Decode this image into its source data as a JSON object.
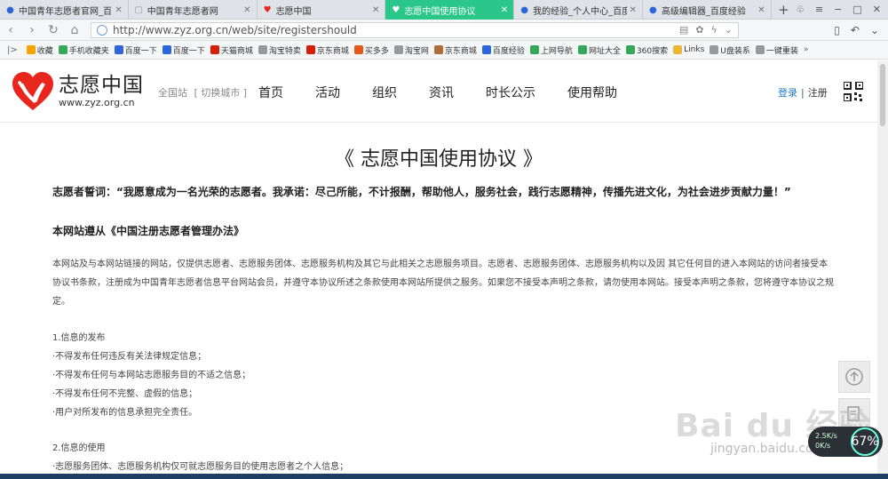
{
  "browser": {
    "tabs": [
      {
        "title": "中国青年志愿者官网_百度",
        "icon": "paw-icon",
        "active": false
      },
      {
        "title": "中国青年志愿者网",
        "icon": "page-icon",
        "active": false
      },
      {
        "title": "志愿中国",
        "icon": "heart-icon",
        "active": false
      },
      {
        "title": "志愿中国使用协议",
        "icon": "heart-icon",
        "active": true
      },
      {
        "title": "我的经验_个人中心_百度经",
        "icon": "paw-icon",
        "active": false
      },
      {
        "title": "高级编辑器_百度经验",
        "icon": "paw-icon",
        "active": false
      }
    ],
    "url": "http://www.zyz.org.cn/web/site/registershould",
    "bookmarks": [
      {
        "label": "收藏",
        "icon": "star-icon",
        "color": "#f3a400"
      },
      {
        "label": "手机收藏夹",
        "icon": "phone-icon",
        "color": "#36a85a"
      },
      {
        "label": "百度一下",
        "icon": "paw-icon",
        "color": "#2d66d8"
      },
      {
        "label": "百度一下",
        "icon": "paw-icon",
        "color": "#2d66d8"
      },
      {
        "label": "天猫商城",
        "icon": "tmall-icon",
        "color": "#d81e06"
      },
      {
        "label": "淘宝特卖",
        "icon": "page-icon",
        "color": "#999999"
      },
      {
        "label": "京东商城",
        "icon": "jd-icon",
        "color": "#d81e06"
      },
      {
        "label": "买多多",
        "icon": "cart-icon",
        "color": "#e8551b"
      },
      {
        "label": "淘宝网",
        "icon": "page-icon",
        "color": "#999999"
      },
      {
        "label": "京东商城",
        "icon": "jd-icon",
        "color": "#b26c3a"
      },
      {
        "label": "百度经验",
        "icon": "paw-icon",
        "color": "#2d66d8"
      },
      {
        "label": "上网导航",
        "icon": "nav-icon",
        "color": "#36a85a"
      },
      {
        "label": "网址大全",
        "icon": "nav-icon",
        "color": "#36a85a"
      },
      {
        "label": "360搜索",
        "icon": "search-icon",
        "color": "#36a85a"
      },
      {
        "label": "Links",
        "icon": "folder-icon",
        "color": "#e8b73a"
      },
      {
        "label": "U盘装系",
        "icon": "page-icon",
        "color": "#999999"
      },
      {
        "label": "一键重装",
        "icon": "page-icon",
        "color": "#999999"
      }
    ]
  },
  "site": {
    "logo_cn": "志愿中国",
    "logo_en": "www.zyz.org.cn",
    "region": "全国站",
    "switch_city": "[ 切换城市 ]",
    "nav": [
      "首页",
      "活动",
      "组织",
      "资讯",
      "时长公示",
      "使用帮助"
    ],
    "login": "登录",
    "separator": "|",
    "register": "注册",
    "brand_color": "#e8261e"
  },
  "content": {
    "title": "《 志愿中国使用协议 》",
    "oath": "志愿者誓词：“我愿意成为一名光荣的志愿者。我承诺：尽己所能，不计报酬，帮助他人，服务社会，践行志愿精神，传播先进文化，为社会进步贡献力量！”",
    "section": "本网站遵从《中国注册志愿者管理办法》",
    "paragraph": "本网站及与本网站链接的网站，仅提供志愿者、志愿服务团体、志愿服务机构及其它与此相关之志愿服务项目。志愿者、志愿服务团体、志愿服务机构以及因 其它任何目的进入本网站的访问者接受本协议书条款，注册成为中国青年志愿者信息平台网站会员，并遵守本协议所述之条款使用本网站所提供之服务。如果您不接受本声明之条款，请勿使用本网站。接受本声明之条款，您将遵守本协议之规定。",
    "list1_heading": "1.信息的发布",
    "list1": [
      "·不得发布任何违反有关法律规定信息；",
      "·不得发布任何与本网站志愿服务目的不适之信息；",
      "·不得发布任何不完整、虚假的信息；",
      "·用户对所发布的信息承担完全责任。"
    ],
    "list2_heading": "2.信息的使用",
    "list2": [
      "·志愿服务团体、志愿服务机构仅可就志愿服务目的使用志愿者之个人信息；"
    ]
  },
  "overlay": {
    "watermark": "Bai du 经验",
    "watermark_url": "jingyan.baidu.com",
    "net_speed": "2.5K/s",
    "net_speed2": "0K/s",
    "usage_percent": "67%"
  }
}
